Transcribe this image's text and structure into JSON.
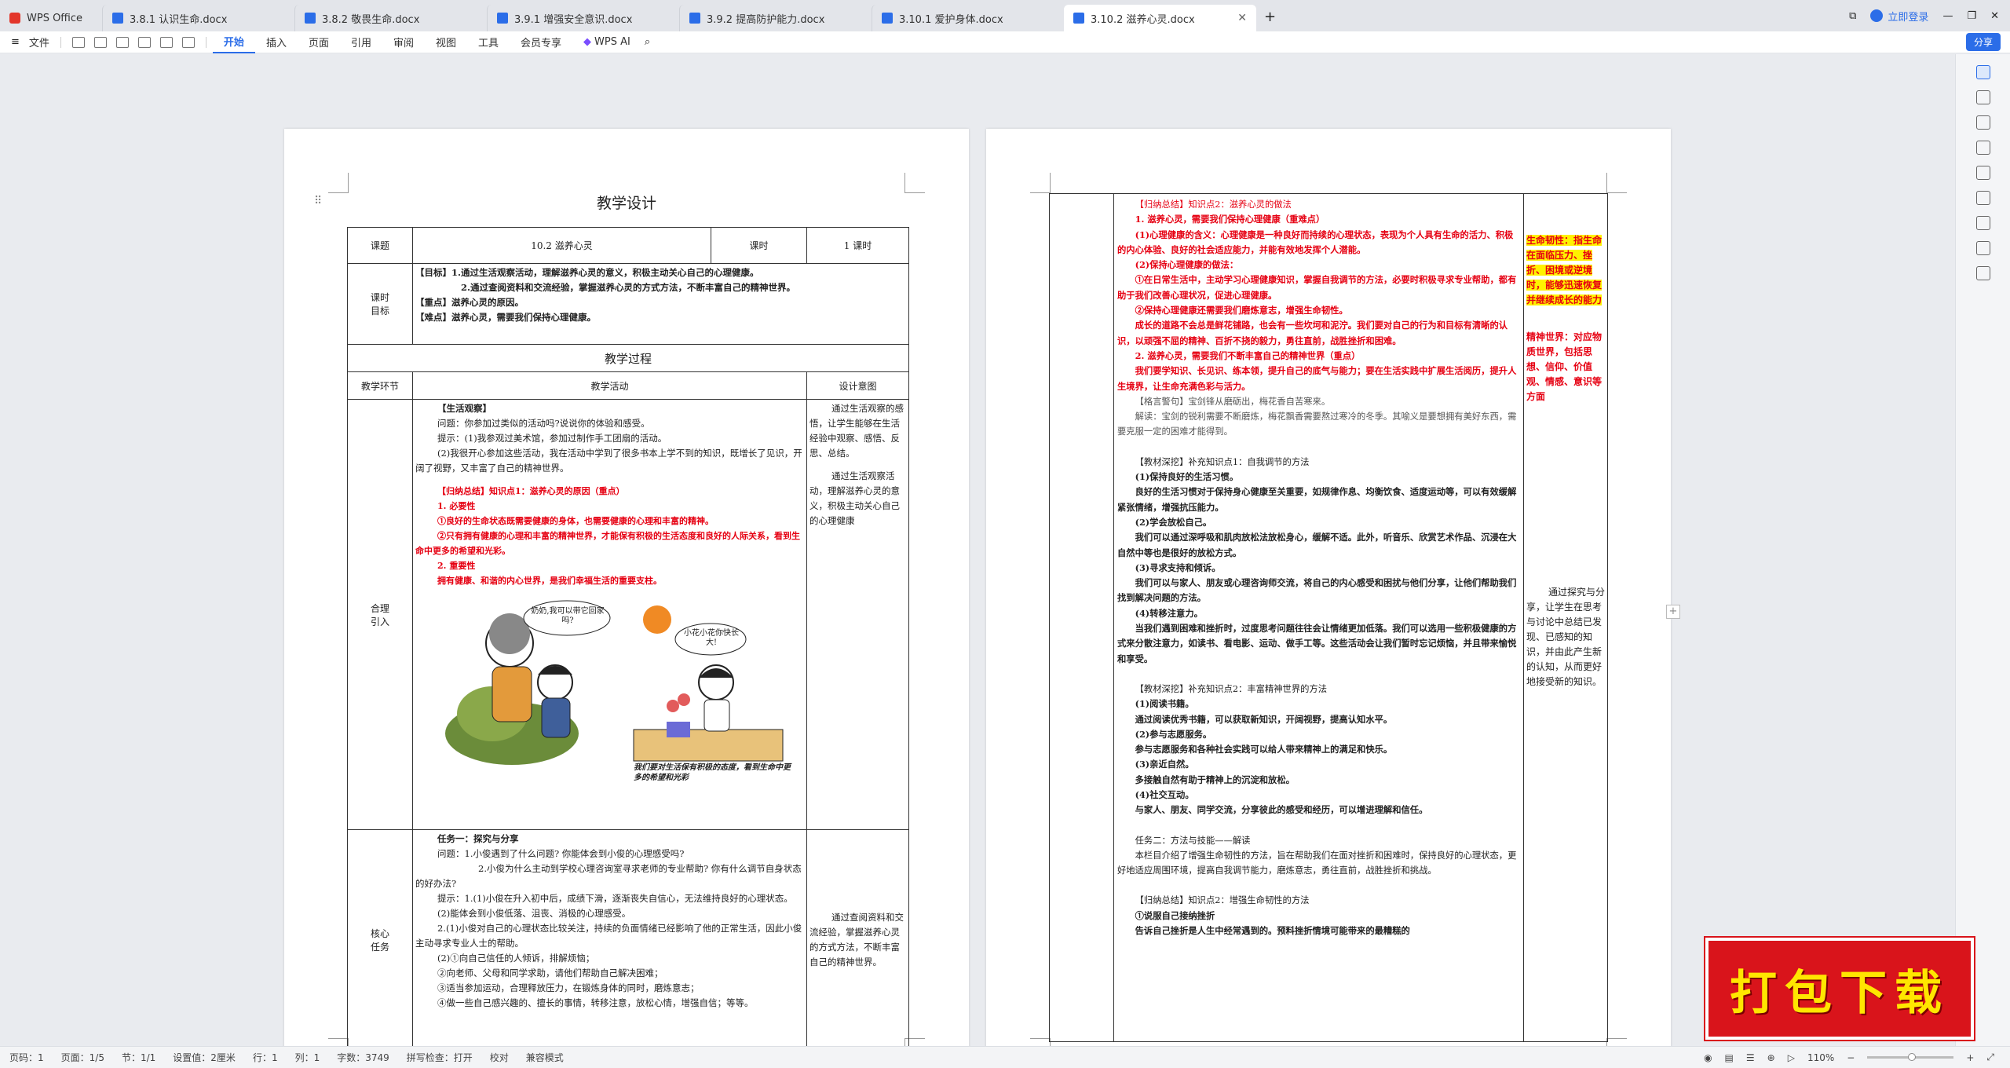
{
  "window": {
    "tabs": [
      {
        "label": "WPS Office",
        "icon": "wps-logo-icon"
      },
      {
        "label": "3.8.1 认识生命.docx",
        "icon": "word-doc-icon"
      },
      {
        "label": "3.8.2 敬畏生命.docx",
        "icon": "word-doc-icon"
      },
      {
        "label": "3.9.1 增强安全意识.docx",
        "icon": "word-doc-icon"
      },
      {
        "label": "3.9.2 提高防护能力.docx",
        "icon": "word-doc-icon"
      },
      {
        "label": "3.10.1 爱护身体.docx",
        "icon": "word-doc-icon"
      },
      {
        "label": "3.10.2 滋养心灵.docx",
        "icon": "word-doc-icon"
      }
    ],
    "login_label": "立即登录"
  },
  "menu": {
    "file": "文件",
    "items": [
      "开始",
      "插入",
      "页面",
      "引用",
      "审阅",
      "视图",
      "工具",
      "会员专享"
    ],
    "active": "开始",
    "wps_ai": "WPS AI",
    "share": "分享"
  },
  "doc": {
    "title": "教学设计",
    "header_row": {
      "k1": "课题",
      "v1": "10.2 滋养心灵",
      "k2": "课时",
      "v2": "1 课时"
    },
    "goal_label": "课时\n目标",
    "goals": [
      "【目标】1.通过生活观察活动，理解滋养心灵的意义，积极主动关心自己的心理健康。",
      "2.通过查阅资料和交流经验，掌握滋养心灵的方式方法，不断丰富自己的精神世界。",
      "【重点】滋养心灵的原因。",
      "【难点】滋养心灵，需要我们保持心理健康。"
    ],
    "process_title": "教学过程",
    "col_headers": [
      "教学环节",
      "教学活动",
      "设计意图"
    ],
    "section1": {
      "stage": "合理\n引入",
      "title": "【生活观察】",
      "q": "问题：你参加过类似的活动吗?说说你的体验和感受。",
      "tip1": "提示：(1)我参观过美术馆，参加过制作手工团扇的活动。",
      "tip2": "(2)我很开心参加这些活动，我在活动中学到了很多书本上学不到的知识，既增长了见识，开阔了视野，又丰富了自己的精神世界。",
      "sum_title": "【归纳总结】知识点1：滋养心灵的原因（重点）",
      "p1": "1. 必要性",
      "p1a": "①良好的生命状态既需要健康的身体，也需要健康的心理和丰富的精神。",
      "p1b": "②只有拥有健康的心理和丰富的精神世界，才能保有积极的生活态度和良好的人际关系，看到生命中更多的希望和光彩。",
      "p2": "2. 重要性",
      "p2a": "拥有健康、和谐的内心世界，是我们幸福生活的重要支柱。",
      "bubble1": "奶奶,我可以带它回家吗?",
      "bubble2": "小花小花你快长大!",
      "caption": "我们要对生活保有积极的态度，看到生命中更多的希望和光彩",
      "intent1": "通过生活观察的感悟，让学生能够在生活经验中观察、感悟、反思、总结。",
      "intent2": "通过生活观察活动，理解滋养心灵的意义，积极主动关心自己的心理健康"
    },
    "section2": {
      "stage": "核心\n任务",
      "title": "任务一：探究与分享",
      "q1": "问题：1.小俊遇到了什么问题? 你能体会到小俊的心理感受吗?",
      "q2": "2.小俊为什么主动到学校心理咨询室寻求老师的专业帮助? 你有什么调节自身状态的好办法?",
      "t1": "提示：1.(1)小俊在升入初中后，成绩下滑，逐渐丧失自信心，无法维持良好的心理状态。",
      "t2": "(2)能体会到小俊低落、沮丧、消极的心理感受。",
      "t3": "2.(1)小俊对自己的心理状态比较关注，持续的负面情绪已经影响了他的正常生活，因此小俊主动寻求专业人士的帮助。",
      "t4": "(2)①向自己信任的人倾诉，排解烦恼；",
      "t5": "②向老师、父母和同学求助，请他们帮助自己解决困难；",
      "t6": "③适当参加运动，合理释放压力，在锻炼身体的同时，磨炼意志；",
      "t7": "④做一些自己感兴趣的、擅长的事情，转移注意，放松心情，增强自信；等等。",
      "intent": "通过查阅资料和交流经验，掌握滋养心灵的方式方法，不断丰富自己的精神世界。"
    },
    "page2": {
      "lines": [
        {
          "t": "【归纳总结】知识点2：滋养心灵的做法",
          "c": "red",
          "indent": true
        },
        {
          "t": "1. 滋养心灵，需要我们保持心理健康（重难点）",
          "c": "red",
          "b": true,
          "indent": true
        },
        {
          "t": "(1)心理健康的含义：心理健康是一种良好而持续的心理状态，表现为个人具有生命的活力、积极的内心体验、良好的社会适应能力，并能有效地发挥个人潜能。",
          "c": "red",
          "b": true,
          "indent": true
        },
        {
          "t": "(2)保持心理健康的做法：",
          "c": "red",
          "b": true,
          "indent": true
        },
        {
          "t": "①在日常生活中，主动学习心理健康知识，掌握自我调节的方法，必要时积极寻求专业帮助，都有助于我们改善心理状况，促进心理健康。",
          "c": "red",
          "b": true,
          "indent": true
        },
        {
          "t": "②保持心理健康还需要我们磨炼意志，增强生命韧性。",
          "c": "red",
          "b": true,
          "indent": true
        },
        {
          "t": "成长的道路不会总是鲜花铺路，也会有一些坎坷和泥泞。我们要对自己的行为和目标有清晰的认识，以顽强不屈的精神、百折不挠的毅力，勇往直前，战胜挫折和困难。",
          "c": "red",
          "b": true,
          "indent": true
        },
        {
          "t": "2. 滋养心灵，需要我们不断丰富自己的精神世界（重点）",
          "c": "red",
          "b": true,
          "indent": true
        },
        {
          "t": "我们要学知识、长见识、练本领，提升自己的底气与能力；要在生活实践中扩展生活阅历，提升人生境界，让生命充满色彩与活力。",
          "c": "red",
          "b": true,
          "indent": true
        },
        {
          "t": "【格言警句】宝剑锋从磨砺出，梅花香自苦寒来。",
          "c": "gray",
          "indent": true
        },
        {
          "t": "解读：宝剑的锐利需要不断磨炼，梅花飘香需要熬过寒冷的冬季。其喻义是要想拥有美好东西，需要克服一定的困难才能得到。",
          "c": "gray",
          "indent": true
        },
        {
          "t": "",
          "c": "none"
        },
        {
          "t": "【教材深挖】补充知识点1：自我调节的方法",
          "c": "dark",
          "indent": true
        },
        {
          "t": "(1)保持良好的生活习惯。",
          "c": "dark",
          "b": true,
          "indent": true
        },
        {
          "t": "良好的生活习惯对于保持身心健康至关重要，如规律作息、均衡饮食、适度运动等，可以有效缓解紧张情绪，增强抗压能力。",
          "c": "dark",
          "b": true,
          "indent": true
        },
        {
          "t": "(2)学会放松自己。",
          "c": "dark",
          "b": true,
          "indent": true
        },
        {
          "t": "我们可以通过深呼吸和肌肉放松法放松身心，缓解不适。此外，听音乐、欣赏艺术作品、沉浸在大自然中等也是很好的放松方式。",
          "c": "dark",
          "b": true,
          "indent": true
        },
        {
          "t": "(3)寻求支持和倾诉。",
          "c": "dark",
          "b": true,
          "indent": true
        },
        {
          "t": "我们可以与家人、朋友或心理咨询师交流，将自己的内心感受和困扰与他们分享，让他们帮助我们找到解决问题的方法。",
          "c": "dark",
          "b": true,
          "indent": true
        },
        {
          "t": "(4)转移注意力。",
          "c": "dark",
          "b": true,
          "indent": true
        },
        {
          "t": "当我们遇到困难和挫折时，过度思考问题往往会让情绪更加低落。我们可以选用一些积极健康的方式来分散注意力，如读书、看电影、运动、做手工等。这些活动会让我们暂时忘记烦恼，并且带来愉悦和享受。",
          "c": "dark",
          "b": true,
          "indent": true
        },
        {
          "t": "",
          "c": "none"
        },
        {
          "t": "【教材深挖】补充知识点2：丰富精神世界的方法",
          "c": "dark",
          "indent": true
        },
        {
          "t": "(1)阅读书籍。",
          "c": "dark",
          "b": true,
          "indent": true
        },
        {
          "t": "通过阅读优秀书籍，可以获取新知识，开阔视野，提高认知水平。",
          "c": "dark",
          "b": true,
          "indent": true
        },
        {
          "t": "(2)参与志愿服务。",
          "c": "dark",
          "b": true,
          "indent": true
        },
        {
          "t": "参与志愿服务和各种社会实践可以给人带来精神上的满足和快乐。",
          "c": "dark",
          "b": true,
          "indent": true
        },
        {
          "t": "(3)亲近自然。",
          "c": "dark",
          "b": true,
          "indent": true
        },
        {
          "t": "多接触自然有助于精神上的沉淀和放松。",
          "c": "dark",
          "b": true,
          "indent": true
        },
        {
          "t": "(4)社交互动。",
          "c": "dark",
          "b": true,
          "indent": true
        },
        {
          "t": "与家人、朋友、同学交流，分享彼此的感受和经历，可以增进理解和信任。",
          "c": "dark",
          "b": true,
          "indent": true
        },
        {
          "t": "",
          "c": "none"
        },
        {
          "t": "任务二：方法与技能——解读",
          "c": "dark",
          "indent": true
        },
        {
          "t": "本栏目介绍了增强生命韧性的方法，旨在帮助我们在面对挫折和困难时，保持良好的心理状态，更好地适应周围环境，提高自我调节能力，磨炼意志，勇往直前，战胜挫折和挑战。",
          "c": "dark",
          "indent": true
        },
        {
          "t": "",
          "c": "none"
        },
        {
          "t": "【归纳总结】知识点2：增强生命韧性的方法",
          "c": "dark",
          "indent": true
        },
        {
          "t": "①说服自己接纳挫折",
          "c": "dark",
          "b": true,
          "indent": true
        },
        {
          "t": "告诉自己挫折是人生中经常遇到的。预料挫折情境可能带来的最糟糕的",
          "c": "dark",
          "b": true,
          "indent": true
        }
      ],
      "side1": "生命韧性：指生命在面临压力、挫折、困境或逆境时，能够迅速恢复并继续成长的能力",
      "side2": "精神世界：对应物质世界，包括思想、信仰、价值观、情感、意识等方面",
      "side3": "通过探究与分享，让学生在思考与讨论中总结已发现、已感知的知识，并由此产生新的认知，从而更好地接受新的知识。"
    }
  },
  "status": {
    "page_no": "页码：1",
    "pages": "页面：1/5",
    "section": "节：1/1",
    "setting": "设置值：2厘米",
    "row": "行：1",
    "col": "列：1",
    "words": "字数：3749",
    "spell": "拼写检查：打开",
    "proof": "校对",
    "compat": "兼容模式",
    "zoom": "110%"
  },
  "banner": "打包下载"
}
